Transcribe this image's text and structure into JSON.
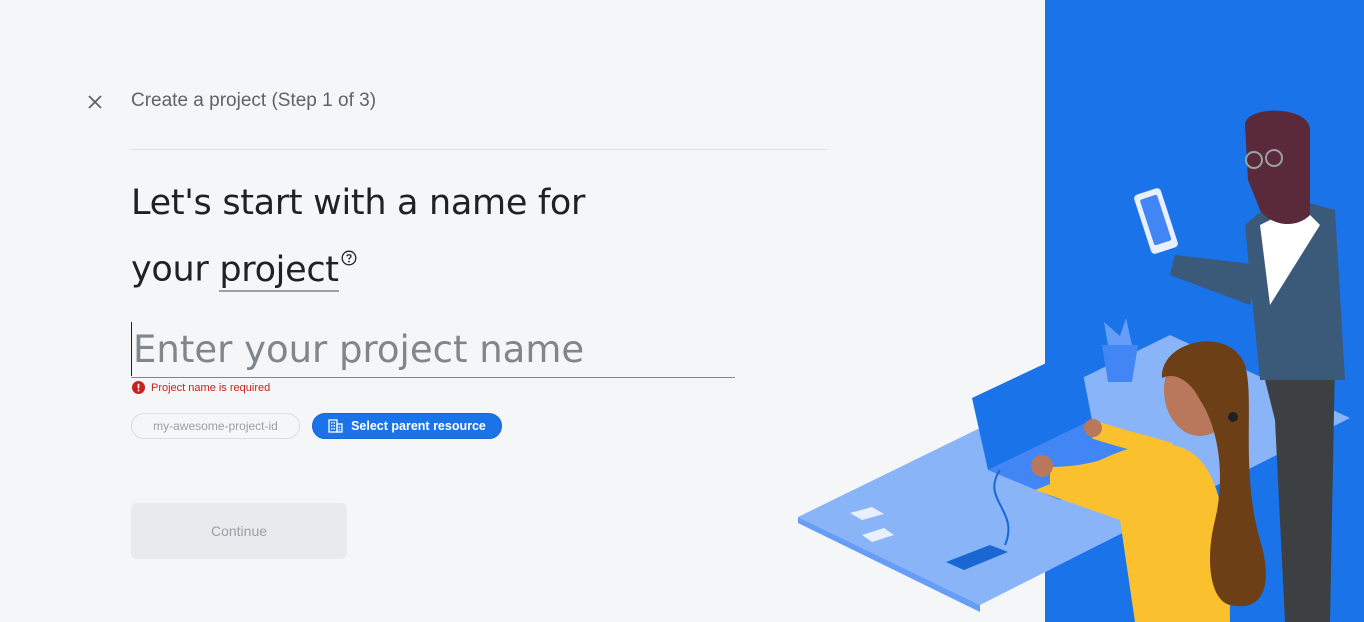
{
  "header": {
    "close_icon": "close-icon",
    "title": "Create a project (Step 1 of 3)"
  },
  "main": {
    "headline_part1": "Let's start with a name for",
    "headline_part2": "your ",
    "headline_term": "project",
    "help_icon": "help-circle-icon"
  },
  "form": {
    "name_placeholder": "Enter your project name",
    "name_value": "",
    "error_icon": "error-icon",
    "error_text": "Project name is required",
    "project_id": "my-awesome-project-id",
    "parent_icon": "building-icon",
    "parent_label": "Select parent resource",
    "continue_label": "Continue"
  },
  "colors": {
    "accent": "#1a73e8",
    "error": "#c5221f",
    "illustration_bg": "#1a73e8"
  }
}
